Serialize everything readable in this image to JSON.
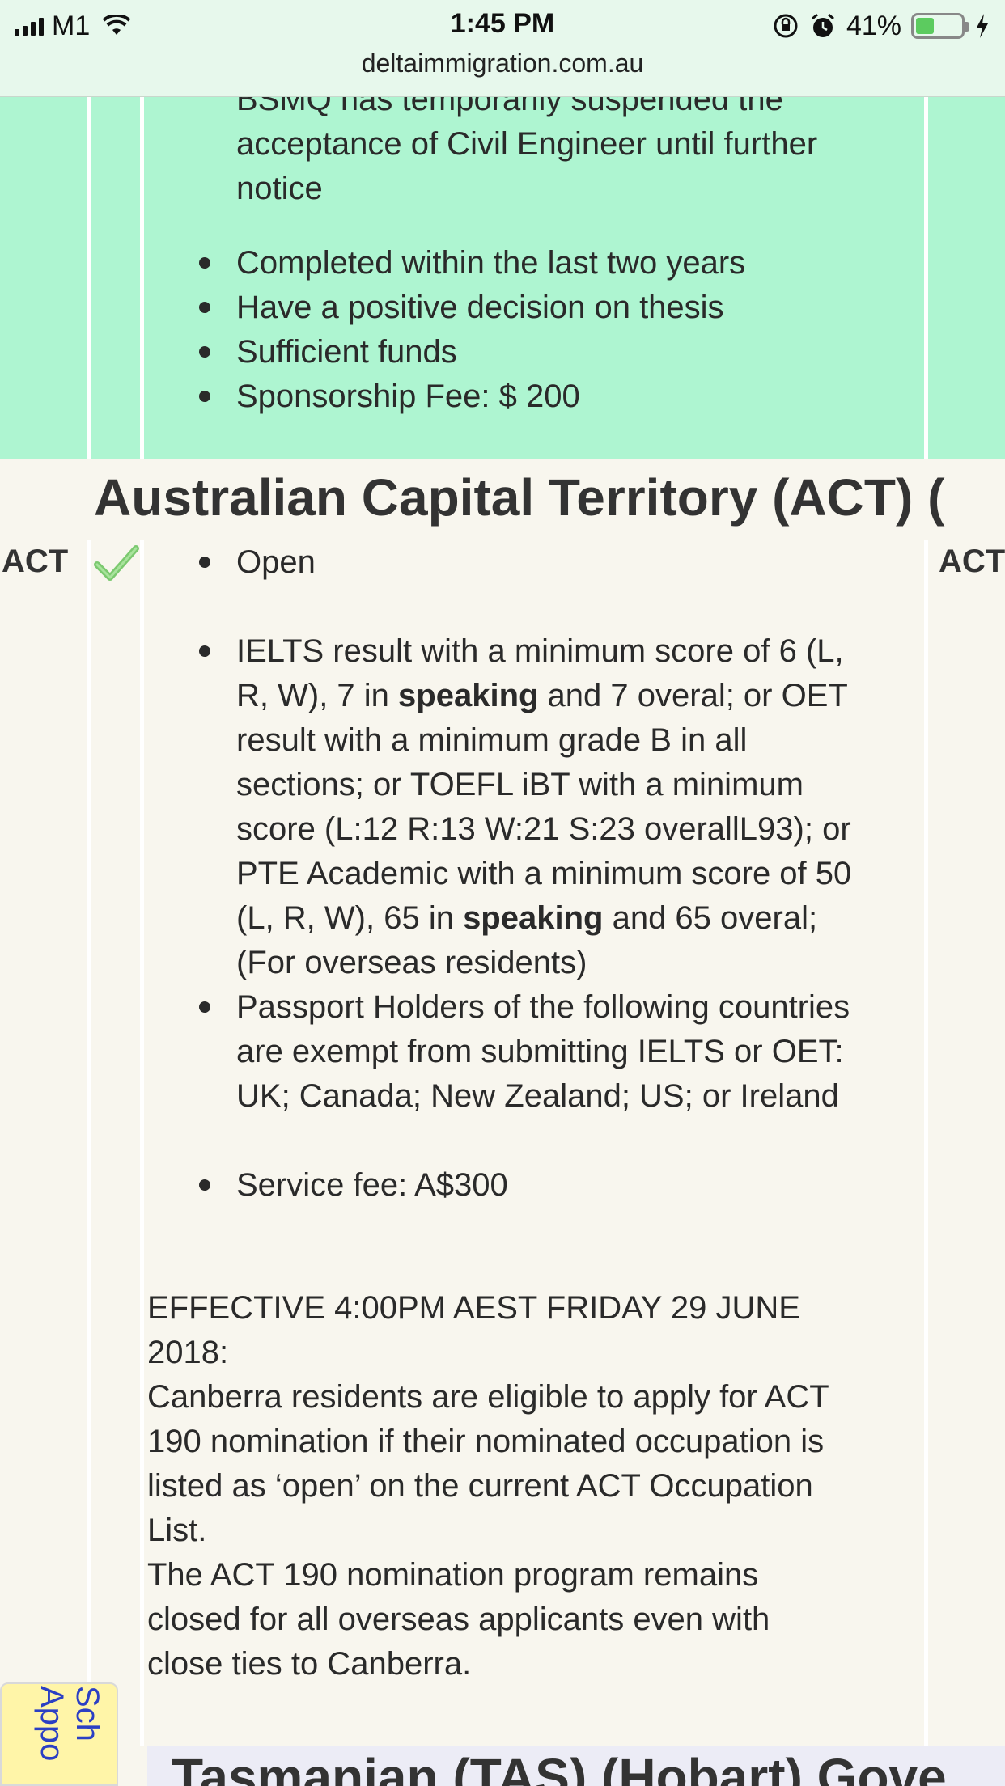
{
  "status_bar": {
    "carrier": "M1",
    "time": "1:45 PM",
    "battery_percent": "41%",
    "battery_level": 0.41,
    "url": "deltaimmigration.com.au"
  },
  "green_section": {
    "lines": [
      "BSMQ has temporarily suspended the",
      "acceptance of Civil Engineer until further",
      "notice"
    ],
    "items": [
      "Completed within the last two years",
      "Have a positive decision on thesis",
      "Sufficient funds",
      "Sponsorship Fee: $ 200"
    ]
  },
  "act_section": {
    "heading": "Australian Capital Territory (ACT) (",
    "row_label": "ACT",
    "row_label_right": "ACT",
    "status": "Open",
    "english": {
      "line1": "IELTS result with a minimum score of 6 (L,",
      "line2_a": "R, W), 7 in ",
      "line2_b": "speaking",
      "line2_c": " and 7 overal; or OET",
      "line3": "result with a minimum grade B in all",
      "line4": "sections; or TOEFL iBT with a minimum",
      "line5": "score (L:12 R:13 W:21 S:23 overallL93); or",
      "line6": "PTE Academic with a minimum score of 50",
      "line7_a": "(L, R, W), 65 in ",
      "line7_b": "speaking",
      "line7_c": " and 65 overal;",
      "line8": "(For overseas residents)"
    },
    "exempt": [
      "Passport Holders of the following countries",
      "are exempt from submitting IELTS or OET:",
      "UK; Canada; New Zealand; US; or Ireland"
    ],
    "service_fee": "Service fee: A$300",
    "notice": {
      "line1": "EFFECTIVE 4:00PM AEST FRIDAY 29 JUNE",
      "line2": "2018:",
      "line3": "Canberra residents are eligible to apply for ACT",
      "line4": "190 nomination if their nominated occupation is",
      "line5": "listed as ‘open’ on the current ACT Occupation",
      "line6": "List.",
      "line7": "The ACT 190 nomination program remains",
      "line8": "closed for all overseas applicants even with",
      "line9": "close ties to Canberra."
    }
  },
  "tas_section": {
    "heading": "Tasmanian (TAS) (Hobart) Gove"
  },
  "floating_tab": {
    "line1": "Sch",
    "line2": "Appo"
  }
}
